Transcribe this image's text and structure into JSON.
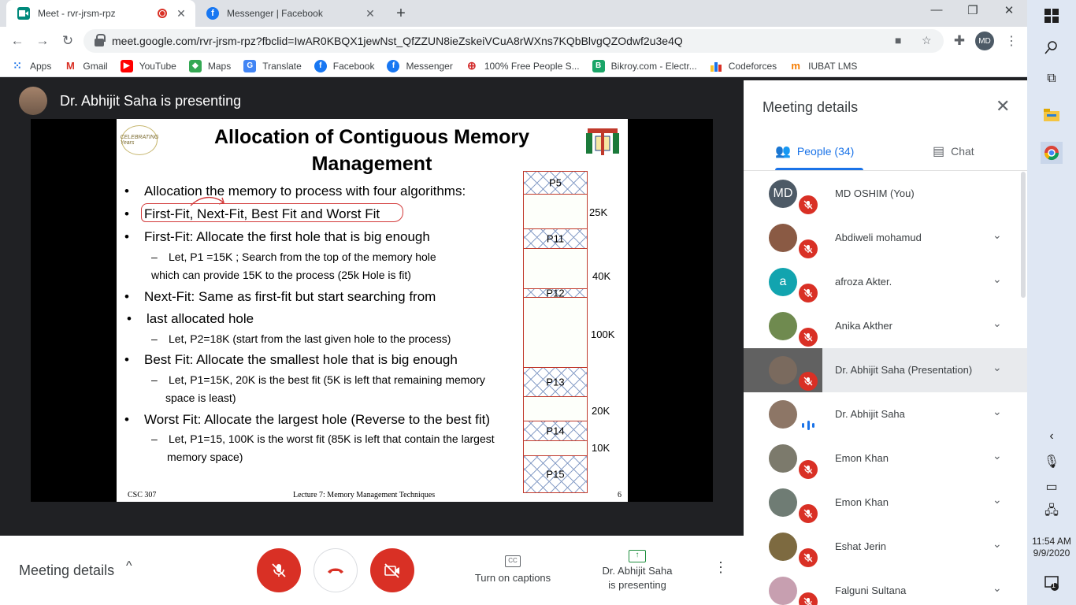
{
  "browser": {
    "tabs": [
      {
        "title": "Meet - rvr-jrsm-rpz",
        "active": true,
        "recording": true
      },
      {
        "title": "Messenger | Facebook",
        "active": false
      }
    ],
    "url": "meet.google.com/rvr-jrsm-rpz?fbclid=IwAR0KBQX1jewNst_QfZZUN8ieZskeiVCuA8rWXns7KQbBlvgQZOdwf2u3e4Q",
    "profile_initials": "MD",
    "bookmarks": [
      "Apps",
      "Gmail",
      "YouTube",
      "Maps",
      "Translate",
      "Facebook",
      "Messenger",
      "100% Free People S...",
      "Bikroy.com - Electr...",
      "Codeforces",
      "IUBAT LMS"
    ]
  },
  "meet": {
    "presenter_label": "Dr. Abhijit Saha is presenting",
    "slide": {
      "title_line1": "Allocation of Contiguous Memory",
      "title_line2": "Management",
      "logo_left_text": "CELEBRATING Years",
      "logo_right_text": "IUBAT",
      "bullets": [
        "Allocation the memory to process with four algorithms:",
        "First-Fit, Next-Fit, Best Fit and Worst Fit",
        "First-Fit: Allocate the first hole that is big enough",
        "Next-Fit: Same as first-fit but start searching from",
        "last allocated hole",
        "Best Fit:  Allocate the smallest hole that is big enough",
        "Worst Fit: Allocate the largest hole (Reverse to the best fit)"
      ],
      "subbullets": [
        "Let, P1 =15K ; Search from the top of the memory hole",
        "which can provide 15K to the process (25k Hole is fit)",
        "Let, P2=18K (start from the last given hole to the process)",
        "Let, P1=15K, 20K is the best fit (5K is left that remaining memory",
        "space is least)",
        "Let, P1=15, 100K is the worst fit (85K is left that contain the largest",
        "memory space)"
      ],
      "memory_blocks": [
        "P5",
        "",
        "P11",
        "",
        "P12",
        "",
        "P13",
        "",
        "P14",
        "",
        "P15"
      ],
      "hole_sizes": [
        "25K",
        "40K",
        "100K",
        "20K",
        "10K"
      ],
      "footer_left": "CSC 307",
      "footer_center": "Lecture 7:  Memory Management Techniques",
      "footer_right": "6"
    }
  },
  "bottom_bar": {
    "meeting_details": "Meeting details",
    "captions_label": "Turn on captions",
    "captions_icon": "CC",
    "present_line1": "Dr. Abhijit Saha",
    "present_line2": "is presenting"
  },
  "panel": {
    "title": "Meeting details",
    "tab_people": "People (34)",
    "tab_chat": "Chat",
    "participants": [
      {
        "name": "MD OSHIM (You)",
        "initials": "MD",
        "color": "#4d5a66",
        "muted": true
      },
      {
        "name": "Abdiweli mohamud",
        "initials": "",
        "color": "#8a5a44",
        "muted": true
      },
      {
        "name": "afroza Akter.",
        "initials": "a",
        "color": "#12a4af",
        "muted": true
      },
      {
        "name": "Anika Akther",
        "initials": "",
        "color": "#6f8a4f",
        "muted": true
      },
      {
        "name": "Dr. Abhijit Saha (Presentation)",
        "initials": "",
        "color": "#7a6a5e",
        "muted": true,
        "highlight": true
      },
      {
        "name": "Dr. Abhijit Saha",
        "initials": "",
        "color": "#8d7666",
        "muted": false
      },
      {
        "name": "Emon Khan",
        "initials": "",
        "color": "#7c7a6c",
        "muted": true
      },
      {
        "name": "Emon Khan",
        "initials": "",
        "color": "#6f7c74",
        "muted": true
      },
      {
        "name": "Eshat Jerin",
        "initials": "",
        "color": "#7d6a40",
        "muted": true
      },
      {
        "name": "Falguni Sultana",
        "initials": "",
        "color": "#c79fb0",
        "muted": true
      }
    ]
  },
  "taskbar": {
    "time": "11:54 AM",
    "date": "9/9/2020",
    "notification_count": "1"
  }
}
